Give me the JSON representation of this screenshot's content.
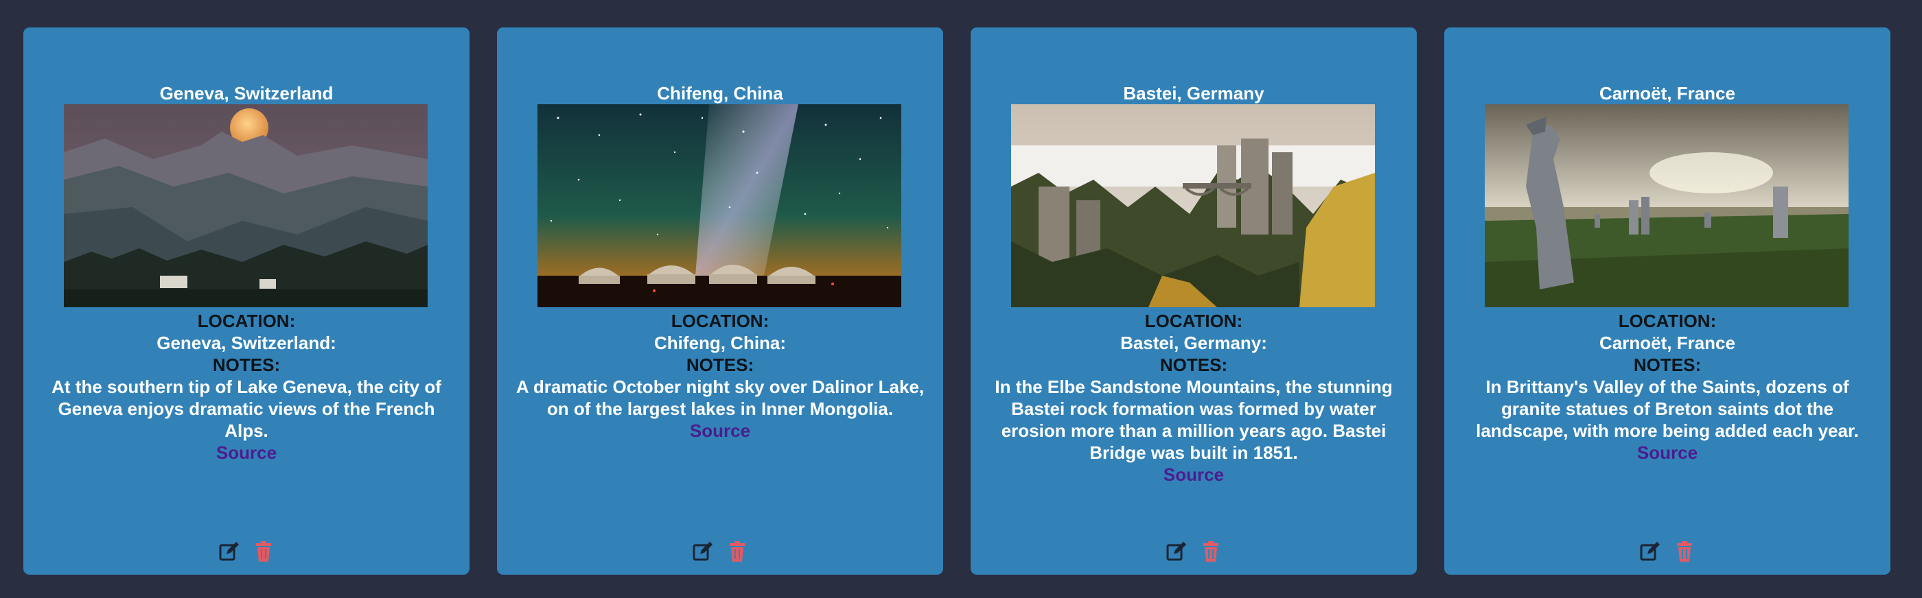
{
  "colors": {
    "page_background": "#292e41",
    "card_background": "#3282b8",
    "label_text": "#0f1419",
    "value_text": "#ffffff",
    "source_link": "#4c1d8f",
    "edit_icon": "#1b2433",
    "delete_icon": "#e15b64"
  },
  "cards": [
    {
      "title": "Geneva, Switzerland",
      "location_label": "LOCATION:",
      "location_value": "Geneva, Switzerland:",
      "notes_label": "NOTES:",
      "notes": "At the southern tip of Lake Geneva, the city of Geneva enjoys dramatic views of the French Alps.",
      "source_label": "Source",
      "image_alt": "moonrise over mountains"
    },
    {
      "title": "Chifeng, China",
      "location_label": "LOCATION:",
      "location_value": "Chifeng, China:",
      "notes_label": "NOTES:",
      "notes": "A dramatic October night sky over Dalinor Lake, on of the largest lakes in Inner Mongolia.",
      "source_label": "Source",
      "image_alt": "milky way over yurts"
    },
    {
      "title": "Bastei, Germany",
      "location_label": "LOCATION:",
      "location_value": "Bastei, Germany:",
      "notes_label": "NOTES:",
      "notes": "In the Elbe Sandstone Mountains, the stunning Bastei rock formation was formed by water erosion more than a million years ago. Bastei Bridge was built in 1851.",
      "source_label": "Source",
      "image_alt": "sandstone rocks and bridge"
    },
    {
      "title": "Carnoët, France",
      "location_label": "LOCATION:",
      "location_value": "Carnoët, France",
      "notes_label": "NOTES:",
      "notes": "In Brittany's Valley of the Saints, dozens of granite statues of Breton saints dot the landscape, with more being added each year.",
      "source_label": "Source",
      "image_alt": "granite statues in a field"
    }
  ],
  "icons": {
    "edit": "edit-icon",
    "delete": "trash-icon"
  }
}
